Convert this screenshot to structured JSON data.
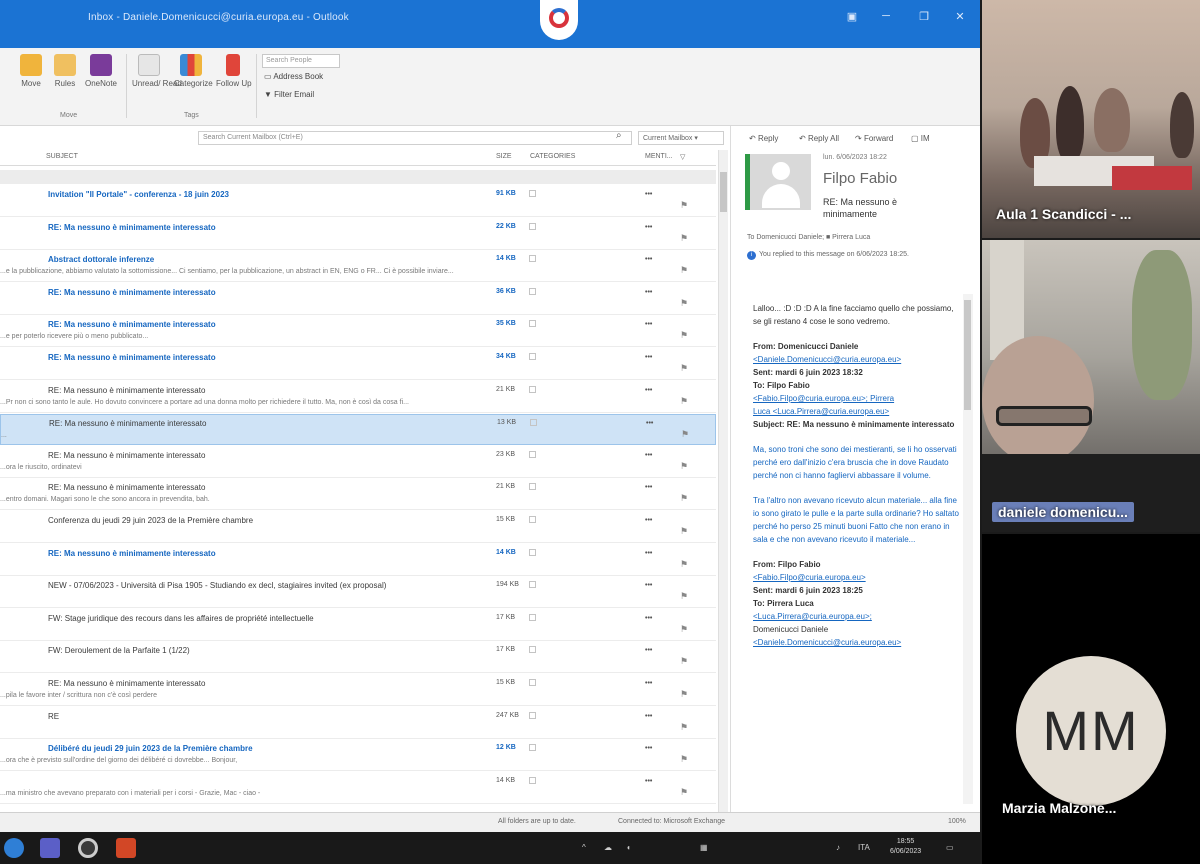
{
  "window": {
    "title": "Inbox - Daniele.Domenicucci@curia.europa.eu - Outlook",
    "controls": [
      "▣",
      "─",
      "❐",
      "✕"
    ]
  },
  "ribbon": {
    "buttons": [
      {
        "label": "Move",
        "icon": "folder-icon",
        "color": "#f0b43c"
      },
      {
        "label": "Rules",
        "icon": "rules-icon",
        "color": "#f0c060"
      },
      {
        "label": "OneNote",
        "icon": "onenote-icon",
        "color": "#7a3b9a"
      },
      {
        "label": "Unread/ Read",
        "icon": "envelope-icon",
        "color": "#e6e6e6"
      },
      {
        "label": "Categorize",
        "icon": "categorize-icon",
        "color": "#3a8ad6"
      },
      {
        "label": "Follow Up",
        "icon": "flag-icon",
        "color": "#e0453a"
      }
    ],
    "groups": [
      "Move",
      "Tags"
    ],
    "search_people": "Search People",
    "address_book": "Address Book",
    "filter_email": "Filter Email"
  },
  "search": {
    "placeholder": "Search Current Mailbox (Ctrl+E)",
    "scope": "Current Mailbox"
  },
  "columns": [
    "SUBJECT",
    "SIZE",
    "CATEGORIES",
    "MENTI...",
    "▽"
  ],
  "messages": [
    {
      "subject": "Invitation \"Il Portale\" - conferenza - 18 juin 2023",
      "preview": "",
      "size": "91 KB",
      "unread": true,
      "selected": false
    },
    {
      "subject": "RE: Ma nessuno è minimamente interessato",
      "preview": "",
      "size": "22 KB",
      "unread": true,
      "selected": false
    },
    {
      "subject": "Abstract dottorale inferenze",
      "preview": "...e la pubblicazione, abbiamo valutato la sottomissione... Ci sentiamo, per la pubblicazione, un abstract in EN, ENG o FR... Ci è possibile inviare...",
      "size": "14 KB",
      "unread": true,
      "selected": false
    },
    {
      "subject": "RE: Ma nessuno è minimamente interessato",
      "preview": "",
      "size": "36 KB",
      "unread": true,
      "selected": false
    },
    {
      "subject": "RE: Ma nessuno è minimamente interessato",
      "preview": "...e per poterlo ricevere più o meno pubblicato...",
      "size": "35 KB",
      "unread": true,
      "selected": false
    },
    {
      "subject": "RE: Ma nessuno è minimamente interessato",
      "preview": "",
      "size": "34 KB",
      "unread": true,
      "selected": false
    },
    {
      "subject": "RE: Ma nessuno è minimamente interessato",
      "preview": "...Pr non ci sono tanto le aule. Ho dovuto convincere a portare ad una donna molto per richiedere il tutto. Ma, non è così da cosa fi...",
      "size": "21 KB",
      "unread": false,
      "selected": false
    },
    {
      "subject": "RE: Ma nessuno è minimamente interessato",
      "preview": "...",
      "size": "13 KB",
      "unread": false,
      "selected": true
    },
    {
      "subject": "RE: Ma nessuno è minimamente interessato",
      "preview": "...ora le riuscito, ordinatevi",
      "size": "23 KB",
      "unread": false,
      "selected": false
    },
    {
      "subject": "RE: Ma nessuno è minimamente interessato",
      "preview": "...entro domani. Magari sono le che sono ancora in prevendita, bah.",
      "size": "21 KB",
      "unread": false,
      "selected": false
    },
    {
      "subject": "Conferenza du jeudi 29 juin 2023 de la Première chambre",
      "preview": "",
      "size": "15 KB",
      "unread": false,
      "selected": false
    },
    {
      "subject": "RE: Ma nessuno è minimamente interessato",
      "preview": "",
      "size": "14 KB",
      "unread": true,
      "selected": false
    },
    {
      "subject": "NEW - 07/06/2023 - Università di Pisa 1905 - Studiando ex decl, stagiaires invited (ex proposal)",
      "preview": "",
      "size": "194 KB",
      "unread": false,
      "selected": false
    },
    {
      "subject": "FW: Stage juridique des recours dans les affaires de propriété intellectuelle",
      "preview": "",
      "size": "17 KB",
      "unread": false,
      "selected": false
    },
    {
      "subject": "FW: Deroulement de la Parfaite 1 (1/22)",
      "preview": "",
      "size": "17 KB",
      "unread": false,
      "selected": false
    },
    {
      "subject": "RE: Ma nessuno è minimamente interessato",
      "preview": "...pila le favore inter / scrittura non c'è così perdere",
      "size": "15 KB",
      "unread": false,
      "selected": false
    },
    {
      "subject": "RE",
      "preview": "",
      "size": "247 KB",
      "unread": false,
      "selected": false
    },
    {
      "subject": "Délibéré du jeudi 29 juin 2023 de la Première chambre",
      "preview": "...ora che è previsto sull'ordine del giorno dei délibéré ci dovrebbe... Bonjour,",
      "size": "12 KB",
      "unread": true,
      "selected": false
    },
    {
      "subject": "",
      "preview": "...ma ministro che avevano preparato con i materiali per i corsi - Grazie, Mac - ciao -",
      "size": "14 KB",
      "unread": false,
      "selected": false
    }
  ],
  "reading": {
    "actions": [
      "Reply",
      "Reply All",
      "Forward",
      "IM"
    ],
    "date": "lun. 6/06/2023 18:22",
    "sender": "Filpo Fabio",
    "subject": "RE: Ma nessuno è minimamente",
    "to": "To   Domenicucci Daniele; ■ Pirrera Luca",
    "info": "You replied to this message on 6/06/2023 18:25.",
    "body_intro": "Lalloo... :D :D :D A la fine facciamo quello che possiamo, se gli restano 4 cose le sono vedremo.",
    "hdr1_from": "From: Domenicucci Daniele",
    "hdr1_email": "<Daniele.Domenicucci@curia.europa.eu>",
    "hdr1_sent": "Sent: mardi 6 juin 2023 18:32",
    "hdr1_to": "To: Filpo Fabio",
    "hdr1_to_email": "<Fabio.Filpo@curia.europa.eu>; Pirrera",
    "hdr1_cc": "Luca <Luca.Pirrera@curia.europa.eu>",
    "hdr1_subject": "Subject: RE: Ma nessuno è minimamente interessato",
    "body_p1": "Ma, sono troni che sono dei mestieranti, se li ho osservati perché ero dall'inizio c'era bruscia che in dove Raudato perché non ci hanno fagliervi abbassare il volume.",
    "body_p2": "Tra l'altro non avevano ricevuto alcun materiale... alla fine io sono girato le pulle e la parte sulla ordinarie? Ho saltato perché ho perso 25 minuti buoni Fatto che non erano in sala e che non avevano ricevuto il materiale...",
    "hdr2_from": "From: Filpo Fabio",
    "hdr2_email": "<Fabio.Filpo@curia.europa.eu>",
    "hdr2_sent": "Sent: mardi 6 juin 2023 18:25",
    "hdr2_to": "To: Pirrera Luca",
    "hdr2_to_email": "<Luca.Pirrera@curia.europa.eu>;",
    "hdr2_cc": "Domenicucci Daniele",
    "hdr2_cc_email": "<Daniele.Domenicucci@curia.europa.eu>"
  },
  "status": {
    "left": "All folders are up to date.",
    "connection": "Connected to: Microsoft Exchange",
    "zoom": "100%"
  },
  "taskbar": {
    "tray": [
      "^",
      "☁",
      "◖",
      "▦",
      "♪",
      "ITA"
    ],
    "time": "18:55",
    "date": "6/06/2023"
  },
  "participants": [
    {
      "name": "Aula 1 Scandicci - ..."
    },
    {
      "name": "daniele domenicu..."
    },
    {
      "name": "Marzia Malzone...",
      "initials": "MM"
    }
  ]
}
